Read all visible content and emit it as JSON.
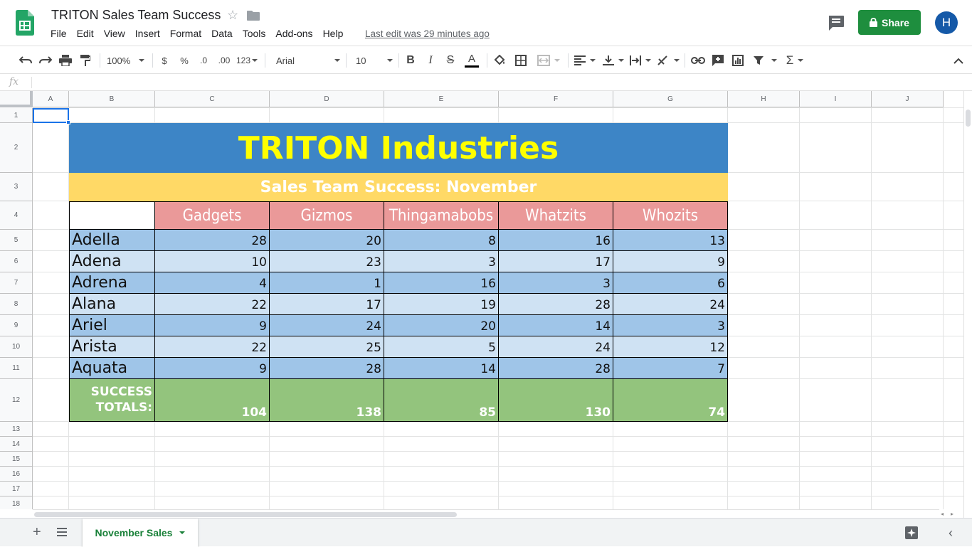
{
  "document": {
    "title": "TRITON Sales Team Success",
    "last_edit": "Last edit was 29 minutes ago",
    "share_label": "Share",
    "avatar_initial": "H"
  },
  "menu": [
    "File",
    "Edit",
    "View",
    "Insert",
    "Format",
    "Data",
    "Tools",
    "Add-ons",
    "Help"
  ],
  "toolbar": {
    "zoom": "100%",
    "currency": "$",
    "percent": "%",
    "decrease_decimal": ".0",
    "increase_decimal": ".00",
    "more_formats": "123",
    "font": "Arial",
    "font_size": "10",
    "bold": "B",
    "italic": "I",
    "strike": "S",
    "text_color": "A",
    "sum": "Σ"
  },
  "formula_bar": {
    "icon": "fx",
    "value": ""
  },
  "columns": [
    "A",
    "B",
    "C",
    "D",
    "E",
    "F",
    "G",
    "H",
    "I",
    "J"
  ],
  "rows": [
    "1",
    "2",
    "3",
    "4",
    "5",
    "6",
    "7",
    "8",
    "9",
    "10",
    "11",
    "12",
    "13",
    "14",
    "15",
    "16",
    "17",
    "18"
  ],
  "sheet": {
    "banner": "TRITON Industries",
    "subtitle": "Sales Team Success: November",
    "products": [
      "Gadgets",
      "Gizmos",
      "Thingamabobs",
      "Whatzits",
      "Whozits"
    ],
    "people": [
      {
        "name": "Adella",
        "values": [
          "28",
          "20",
          "8",
          "16",
          "13"
        ]
      },
      {
        "name": "Adena",
        "values": [
          "10",
          "23",
          "3",
          "17",
          "9"
        ]
      },
      {
        "name": "Adrena",
        "values": [
          "4",
          "1",
          "16",
          "3",
          "6"
        ]
      },
      {
        "name": "Alana",
        "values": [
          "22",
          "17",
          "19",
          "28",
          "24"
        ]
      },
      {
        "name": "Ariel",
        "values": [
          "9",
          "24",
          "20",
          "14",
          "3"
        ]
      },
      {
        "name": "Arista",
        "values": [
          "22",
          "25",
          "5",
          "24",
          "12"
        ]
      },
      {
        "name": "Aquata",
        "values": [
          "9",
          "28",
          "14",
          "28",
          "7"
        ]
      }
    ],
    "totals_label_1": "SUCCESS",
    "totals_label_2": "TOTALS:",
    "totals": [
      "104",
      "138",
      "85",
      "130",
      "74"
    ]
  },
  "bottom": {
    "sheet_tab": "November Sales",
    "add_sheet": "+"
  },
  "colors": {
    "banner_bg": "#3d85c6",
    "banner_text": "#ffff00",
    "subtitle_bg": "#ffd966",
    "product_header_bg": "#ea9999",
    "row_dark": "#9fc5e8",
    "row_light": "#cfe2f3",
    "totals_bg": "#93c47d",
    "share_green": "#1e8e3e"
  }
}
